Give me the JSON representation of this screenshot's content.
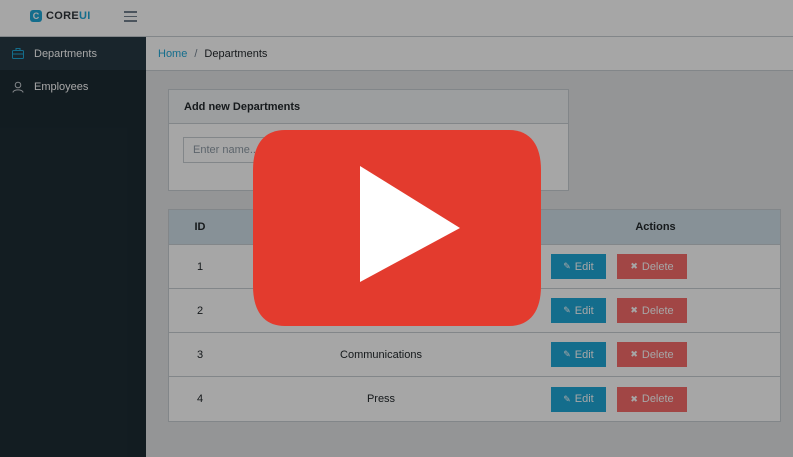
{
  "brand": {
    "prefix": "CORE",
    "suffix": "UI",
    "mark": "C"
  },
  "sidebar": {
    "items": [
      {
        "label": "Departments",
        "icon": "briefcase-icon",
        "active": true
      },
      {
        "label": "Employees",
        "icon": "user-icon",
        "active": false
      }
    ]
  },
  "breadcrumb": {
    "home": "Home",
    "separator": "/",
    "current": "Departments"
  },
  "add_card": {
    "title": "Add new Departments",
    "input_placeholder": "Enter name.."
  },
  "table": {
    "headers": {
      "id": "ID",
      "name": "",
      "actions": "Actions"
    },
    "rows": [
      {
        "id": "1",
        "name": ""
      },
      {
        "id": "2",
        "name": ""
      },
      {
        "id": "3",
        "name": "Communications"
      },
      {
        "id": "4",
        "name": "Press"
      }
    ],
    "edit_label": "Edit",
    "delete_label": "Delete"
  },
  "video_overlay": {
    "icon": "youtube-play-icon"
  },
  "colors": {
    "primary": "#20a8d8",
    "danger": "#f86c6b",
    "sidebar": "#1d2c34",
    "play_red": "#e33b2e"
  }
}
